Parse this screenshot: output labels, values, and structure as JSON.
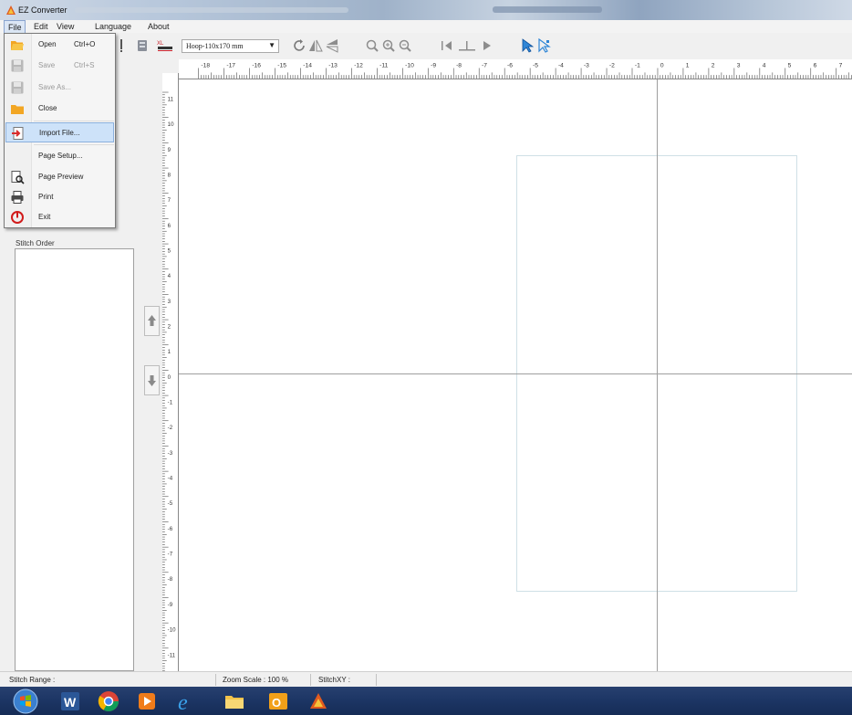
{
  "window": {
    "title": "EZ Converter"
  },
  "menubar": {
    "items": [
      "File",
      "Edit",
      "View",
      "Language",
      "About"
    ]
  },
  "toolbar": {
    "hoop_select": "Hoop-110x170 mm"
  },
  "file_menu": [
    {
      "label": "Open",
      "shortcut": "Ctrl+O",
      "icon": "folder-open-icon",
      "disabled": false
    },
    {
      "label": "Save",
      "shortcut": "Ctrl+S",
      "icon": "floppy-icon",
      "disabled": true
    },
    {
      "label": "Save As...",
      "shortcut": "",
      "icon": "floppy-icon",
      "disabled": true
    },
    {
      "label": "Close",
      "shortcut": "",
      "icon": "folder-icon",
      "disabled": false
    },
    {
      "label": "Import File...",
      "shortcut": "",
      "icon": "import-icon",
      "disabled": false,
      "highlighted": true
    },
    {
      "label": "Page Setup...",
      "shortcut": "",
      "icon": "",
      "disabled": false
    },
    {
      "label": "Page Preview",
      "shortcut": "",
      "icon": "page-preview-icon",
      "disabled": false
    },
    {
      "label": "Print",
      "shortcut": "",
      "icon": "printer-icon",
      "disabled": false
    },
    {
      "label": "Exit",
      "shortcut": "",
      "icon": "exit-icon",
      "disabled": false
    }
  ],
  "left_panel": {
    "stitch_order_label": "Stitch Order"
  },
  "rulers": {
    "top": [
      "-18",
      "-17",
      "-16",
      "-15",
      "-14",
      "-13",
      "-12",
      "-11",
      "-10",
      "-9",
      "-8",
      "-7",
      "-6",
      "-5",
      "-4",
      "-3",
      "-2",
      "-1",
      "0",
      "1",
      "2",
      "3",
      "4",
      "5",
      "6",
      "7"
    ],
    "left": [
      "11",
      "10",
      "9",
      "8",
      "7",
      "6",
      "5",
      "4",
      "3",
      "2",
      "1",
      "0",
      "-1",
      "-2",
      "-3",
      "-4",
      "-5",
      "-6",
      "-7",
      "-8",
      "-9",
      "-10",
      "-11"
    ]
  },
  "statusbar": {
    "stitch_range": "Stitch Range :",
    "zoom_scale": "Zoom Scale : 100 %",
    "stitch_xy": "StitchXY :"
  },
  "taskbar": {
    "apps": [
      "start-orb-icon",
      "word-icon",
      "chrome-icon",
      "media-player-icon",
      "internet-explorer-icon",
      "file-explorer-icon",
      "outlook-icon",
      "ez-converter-icon"
    ]
  },
  "colors": {
    "menu_highlight": "#cde2f9",
    "taskbar": "#1c3564",
    "hoop_outline": "#cfe0e6"
  }
}
